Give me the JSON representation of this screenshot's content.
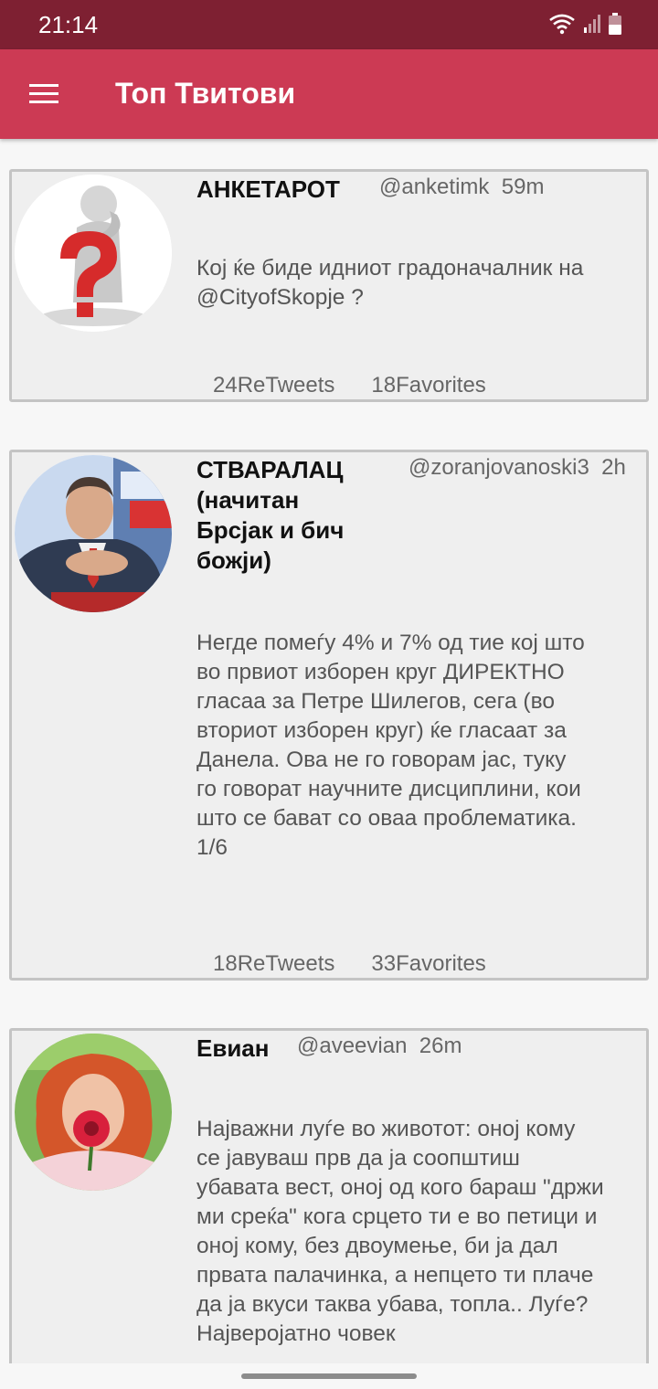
{
  "status_bar": {
    "time": "21:14",
    "icons": [
      "wifi-icon",
      "signal-icon",
      "battery-icon"
    ]
  },
  "app_bar": {
    "title": "Топ Твитови",
    "menu_icon": "menu-icon",
    "color": "#cc3a54"
  },
  "tweets": [
    {
      "name": "АНКЕТАРОТ",
      "handle": "@anketimk",
      "time": "59m",
      "text": "Кој ќе биде идниот градоначалник на @CityofSkopje ?",
      "retweets": "24ReTweets",
      "favorites": "18Favorites",
      "avatar": "question-mark-figure-avatar"
    },
    {
      "name": "СТВАРАЛАЦ (начитан Брсјак и бич божји)",
      "handle": "@zoranjovanoski3",
      "time": "2h",
      "text": "Негде помеѓу 4% и 7% од тие кој што во првиот изборен круг ДИРЕКТНО гласаа за Петре Шилегов, сега (во вториот изборен круг) ќе гласаат за Данела. Ова не го говорам јас, туку го говорат научните дисциплини, кои што се бават со оваа проблематика. 1/6",
      "retweets": "18ReTweets",
      "favorites": "33Favorites",
      "avatar": "man-portrait-avatar"
    },
    {
      "name": "Евиан",
      "handle": "@aveevian",
      "time": "26m",
      "text": "Најважни луѓе во животот: оној кому се јавуваш прв да ја соопштиш убавата вест, оној од кого бараш \"држи ми среќа\" кога срцето ти е во петици и оној кому, без двоумење, би ја дал првата палачинка, а непцето ти плаче да ја вкуси таква убава, топла.. Луѓе? Најверојатно човек",
      "avatar": "woman-with-flower-avatar"
    }
  ]
}
